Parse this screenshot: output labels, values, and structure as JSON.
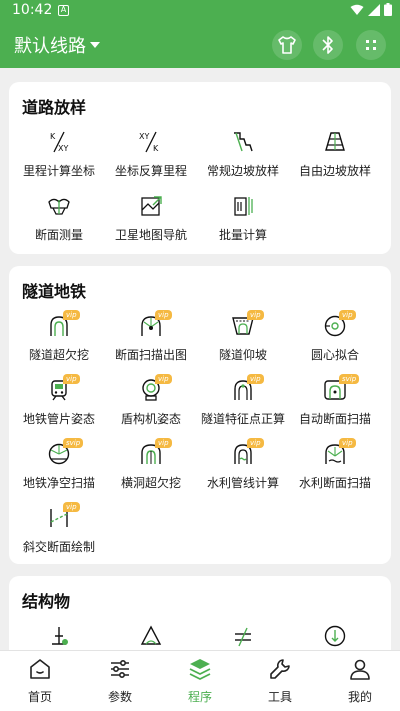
{
  "status_bar": {
    "time": "10:42",
    "notification_letter": "A"
  },
  "app_bar": {
    "route_title": "默认线路",
    "actions": [
      "shirt-icon",
      "bluetooth-icon",
      "grid-dots-icon"
    ]
  },
  "sections": {
    "road": {
      "title": "道路放样",
      "items": [
        {
          "label": "里程计算坐标",
          "icon": "k-to-xy-icon"
        },
        {
          "label": "坐标反算里程",
          "icon": "xy-to-k-icon"
        },
        {
          "label": "常规边坡放样",
          "icon": "regular-slope-icon"
        },
        {
          "label": "自由边坡放样",
          "icon": "free-slope-icon"
        },
        {
          "label": "断面测量",
          "icon": "cross-section-icon"
        },
        {
          "label": "卫星地图导航",
          "icon": "satellite-map-icon"
        },
        {
          "label": "批量计算",
          "icon": "batch-calc-icon"
        }
      ]
    },
    "tunnel": {
      "title": "隧道地铁",
      "badge_vip": "vip",
      "badge_svip": "svip",
      "items": [
        {
          "label": "隧道超欠挖",
          "icon": "tunnel-overbreak-icon",
          "badge": "vip"
        },
        {
          "label": "断面扫描出图",
          "icon": "section-scan-icon",
          "badge": "vip"
        },
        {
          "label": "隧道仰坡",
          "icon": "tunnel-slope-icon",
          "badge": "vip"
        },
        {
          "label": "圆心拟合",
          "icon": "circle-fit-icon",
          "badge": "vip"
        },
        {
          "label": "地铁管片姿态",
          "icon": "metro-segment-icon",
          "badge": "vip"
        },
        {
          "label": "盾构机姿态",
          "icon": "shield-machine-icon",
          "badge": "vip"
        },
        {
          "label": "隧道特征点正算",
          "icon": "tunnel-feature-icon",
          "badge": "vip"
        },
        {
          "label": "自动断面扫描",
          "icon": "auto-scan-icon",
          "badge": "svip"
        },
        {
          "label": "地铁净空扫描",
          "icon": "metro-clearance-icon",
          "badge": "svip"
        },
        {
          "label": "横洞超欠挖",
          "icon": "cross-tunnel-icon",
          "badge": "vip"
        },
        {
          "label": "水利管线计算",
          "icon": "water-pipe-icon",
          "badge": "vip"
        },
        {
          "label": "水利断面扫描",
          "icon": "water-section-icon",
          "badge": "vip"
        },
        {
          "label": "斜交断面绘制",
          "icon": "skew-section-icon",
          "badge": "vip"
        }
      ]
    },
    "structure": {
      "title": "结构物",
      "items": [
        {
          "label": "",
          "icon": "structure-a-icon"
        },
        {
          "label": "",
          "icon": "structure-b-icon"
        },
        {
          "label": "",
          "icon": "structure-c-icon"
        },
        {
          "label": "",
          "icon": "structure-d-icon"
        }
      ]
    }
  },
  "bottom_nav": {
    "items": [
      {
        "label": "首页",
        "icon": "home-icon"
      },
      {
        "label": "参数",
        "icon": "sliders-icon"
      },
      {
        "label": "程序",
        "icon": "layers-icon",
        "active": true
      },
      {
        "label": "工具",
        "icon": "wrench-icon"
      },
      {
        "label": "我的",
        "icon": "person-icon"
      }
    ]
  },
  "colors": {
    "primary": "#4caf50",
    "vip_badge": "#f5b942",
    "background": "#efefef"
  }
}
